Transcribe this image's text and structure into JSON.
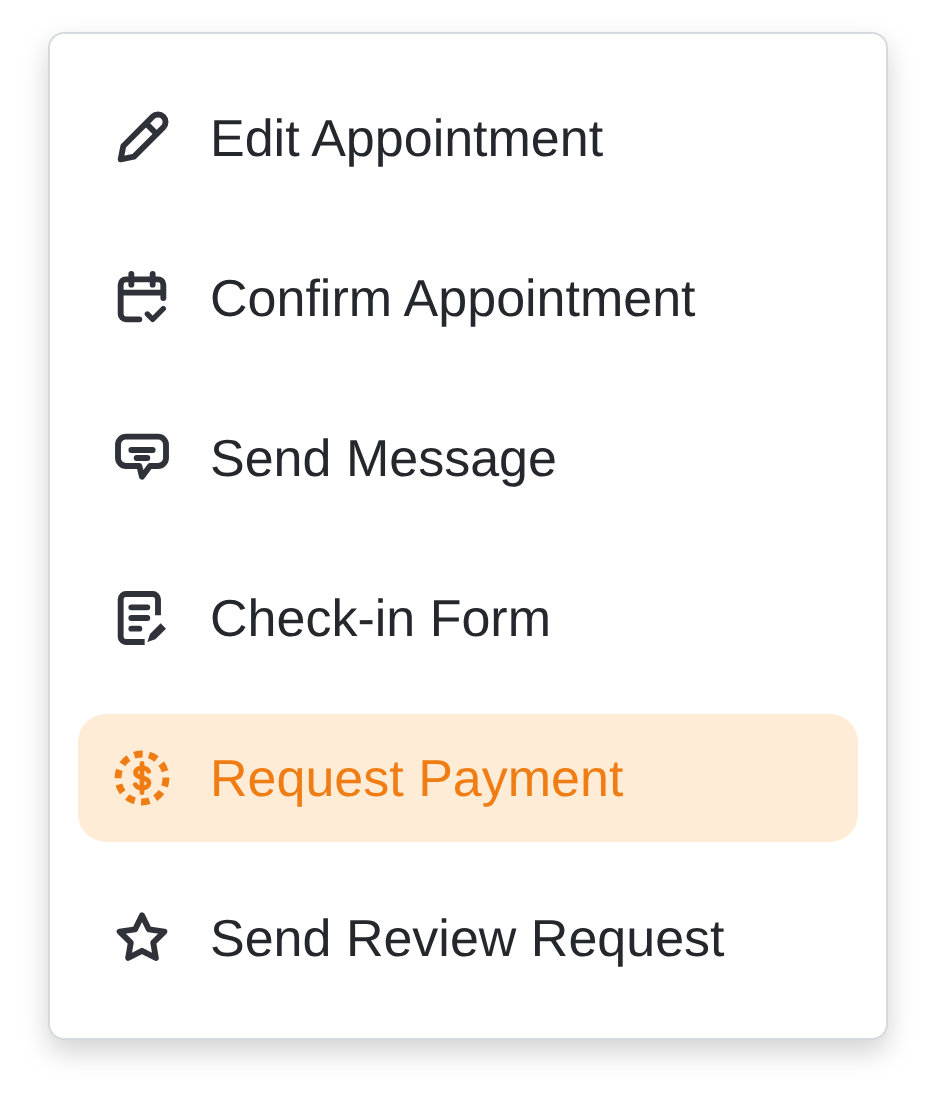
{
  "menu": {
    "items": [
      {
        "kind": "pencil",
        "label": "Edit Appointment",
        "selected": false
      },
      {
        "kind": "calendar-check",
        "label": "Confirm Appointment",
        "selected": false
      },
      {
        "kind": "chat",
        "label": "Send Message",
        "selected": false
      },
      {
        "kind": "form",
        "label": "Check-in Form",
        "selected": false
      },
      {
        "kind": "dollar",
        "label": "Request Payment",
        "selected": true
      },
      {
        "kind": "star",
        "label": "Send Review Request",
        "selected": false
      }
    ]
  }
}
